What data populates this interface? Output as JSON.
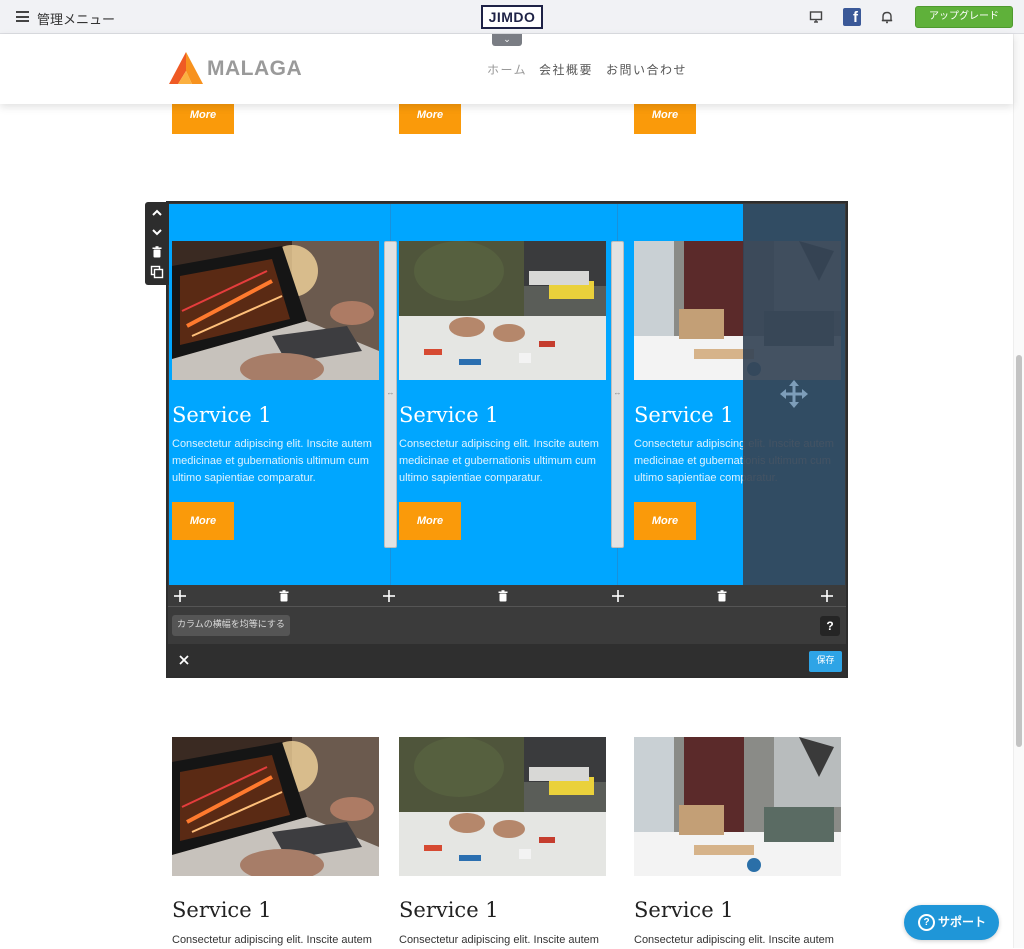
{
  "admin_bar": {
    "menu_label": "管理メニュー",
    "logo": "JIMDO",
    "upgrade_label": "アップグレード",
    "facebook_glyph": "f",
    "icons": [
      "menu-icon",
      "monitor-icon",
      "facebook-icon",
      "bell-icon",
      "chevron-down-icon"
    ]
  },
  "site": {
    "logo_text": "MALAGA",
    "nav": [
      "ホーム",
      "会社概要",
      "お問い合わせ"
    ]
  },
  "top_more_buttons": [
    "More",
    "More",
    "More"
  ],
  "editor": {
    "columns": [
      {
        "title": "Service 1",
        "description": "Consectetur adipiscing elit. Inscite autem medicinae et gubernationis ultimum cum ultimo sapientiae comparatur.",
        "button": "More"
      },
      {
        "title": "Service 1",
        "description": "Consectetur adipiscing elit. Inscite autem medicinae et gubernationis ultimum cum ultimo sapientiae comparatur.",
        "button": "More"
      },
      {
        "title": "Service 1",
        "description": "Consectetur adipiscing elit. Inscite autem medicinae et gubernationis ultimum cum ultimo sapientiae comparatur.",
        "button": "More"
      }
    ],
    "equalize_label": "カラムの横幅を均等にする",
    "help_label": "?",
    "save_label": "保存",
    "colors": {
      "column_bg": "#00a6ff",
      "toolbar": "#3b3b3b",
      "save": "#2ea4e6"
    }
  },
  "bottom_services": [
    {
      "title": "Service 1",
      "description": "Consectetur adipiscing elit. Inscite autem"
    },
    {
      "title": "Service 1",
      "description": "Consectetur adipiscing elit. Inscite autem"
    },
    {
      "title": "Service 1",
      "description": "Consectetur adipiscing elit. Inscite autem"
    }
  ],
  "support_label": "サポート",
  "colors": {
    "accent_orange": "#fa9a0a",
    "upgrade_green": "#5fb13a",
    "support_blue": "#1f96d8"
  }
}
